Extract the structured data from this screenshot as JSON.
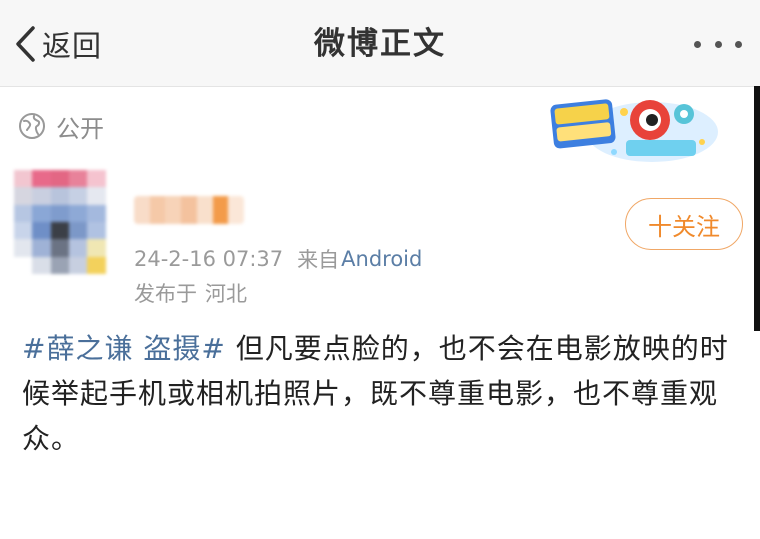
{
  "header": {
    "back_label": "返回",
    "title": "微博正文",
    "more_icon": "more-dots-icon"
  },
  "post": {
    "visibility": "公开",
    "author": {
      "name_blurred": true
    },
    "meta": {
      "time": "24-2-16 07:37",
      "source_prefix": "来自",
      "source": "Android"
    },
    "location": {
      "prefix": "发布于",
      "place": "河北"
    },
    "follow_label": "十关注",
    "hashtag": "#薛之谦 盗摄#",
    "body_text": " 但凡要点脸的，也不会在电影放映的时候举起手机或相机拍照片，既不尊重电影，也不尊重观众。"
  },
  "colors": {
    "link": "#4a6f9a",
    "follow": "#f08a2c",
    "meta": "#9a9a9a"
  }
}
